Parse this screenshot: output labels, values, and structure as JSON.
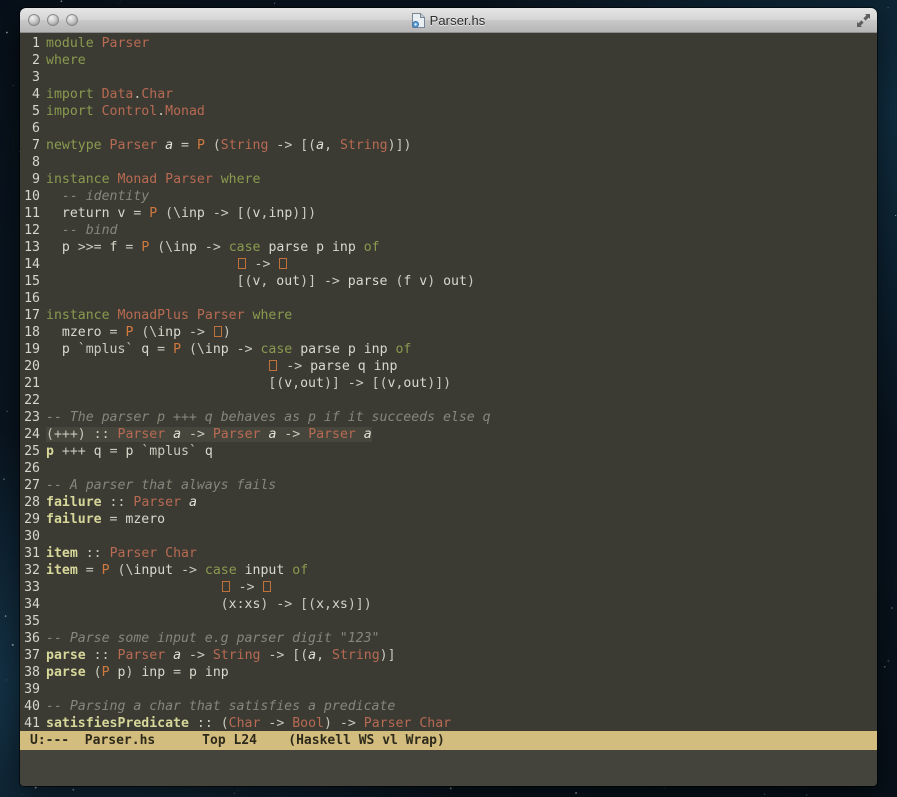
{
  "window": {
    "title": "Parser.hs",
    "traffic_lights": [
      "close",
      "minimize",
      "zoom"
    ],
    "fullscreen_label": "Full Screen"
  },
  "editor": {
    "app": "Emacs",
    "background": "#3b3b34",
    "gutter_color": "#d6d6cc",
    "colors": {
      "keyword": "#8a9a4e",
      "type": "#b86a52",
      "constructor": "#d07a3e",
      "function": "#d7d79a",
      "comment": "#86867a",
      "punctuation": "#c9c9bd",
      "region_highlight": "#46463d",
      "modeline_bg": "#d3bd7e",
      "modeline_fg": "#2d2a1c"
    },
    "lines": [
      {
        "n": "1",
        "text": "module Parser"
      },
      {
        "n": "2",
        "text": "where"
      },
      {
        "n": "3",
        "text": ""
      },
      {
        "n": "4",
        "text": "import Data.Char"
      },
      {
        "n": "5",
        "text": "import Control.Monad"
      },
      {
        "n": "6",
        "text": ""
      },
      {
        "n": "7",
        "text": "newtype Parser a = P (String -> [(a, String)])"
      },
      {
        "n": "8",
        "text": ""
      },
      {
        "n": "9",
        "text": "instance Monad Parser where"
      },
      {
        "n": "10",
        "text": "  -- identity"
      },
      {
        "n": "11",
        "text": "  return v = P (\\inp -> [(v,inp)])"
      },
      {
        "n": "12",
        "text": "  -- bind"
      },
      {
        "n": "13",
        "text": "  p >>= f = P (\\inp -> case parse p inp of"
      },
      {
        "n": "14",
        "text": "                        [] -> []"
      },
      {
        "n": "15",
        "text": "                        [(v, out)] -> parse (f v) out)"
      },
      {
        "n": "16",
        "text": ""
      },
      {
        "n": "17",
        "text": "instance MonadPlus Parser where"
      },
      {
        "n": "18",
        "text": "  mzero = P (\\inp -> [])"
      },
      {
        "n": "19",
        "text": "  p `mplus` q = P (\\inp -> case parse p inp of"
      },
      {
        "n": "20",
        "text": "                            [] -> parse q inp"
      },
      {
        "n": "21",
        "text": "                            [(v,out)] -> [(v,out)])"
      },
      {
        "n": "22",
        "text": ""
      },
      {
        "n": "23",
        "text": "-- The parser p +++ q behaves as p if it succeeds else q"
      },
      {
        "n": "24",
        "text": "(+++) :: Parser a -> Parser a -> Parser a"
      },
      {
        "n": "25",
        "text": "p +++ q = p `mplus` q"
      },
      {
        "n": "26",
        "text": ""
      },
      {
        "n": "27",
        "text": "-- A parser that always fails"
      },
      {
        "n": "28",
        "text": "failure :: Parser a"
      },
      {
        "n": "29",
        "text": "failure = mzero"
      },
      {
        "n": "30",
        "text": ""
      },
      {
        "n": "31",
        "text": "item :: Parser Char"
      },
      {
        "n": "32",
        "text": "item = P (\\input -> case input of"
      },
      {
        "n": "33",
        "text": "                      [] -> []"
      },
      {
        "n": "34",
        "text": "                      (x:xs) -> [(x,xs)])"
      },
      {
        "n": "35",
        "text": ""
      },
      {
        "n": "36",
        "text": "-- Parse some input e.g parser digit \"123\""
      },
      {
        "n": "37",
        "text": "parse :: Parser a -> String -> [(a, String)]"
      },
      {
        "n": "38",
        "text": "parse (P p) inp = p inp"
      },
      {
        "n": "39",
        "text": ""
      },
      {
        "n": "40",
        "text": "-- Parsing a char that satisfies a predicate"
      },
      {
        "n": "41",
        "text": "satisfiesPredicate :: (Char -> Bool) -> Parser Char"
      }
    ]
  },
  "modeline": {
    "text": "U:---  Parser.hs      Top L24    (Haskell WS vl Wrap)",
    "encoding_status": "U:---",
    "buffer_name": "Parser.hs",
    "position": "Top",
    "line_indicator": "L24",
    "modes": "(Haskell WS vl Wrap)"
  },
  "minibuffer": {
    "text": ""
  }
}
